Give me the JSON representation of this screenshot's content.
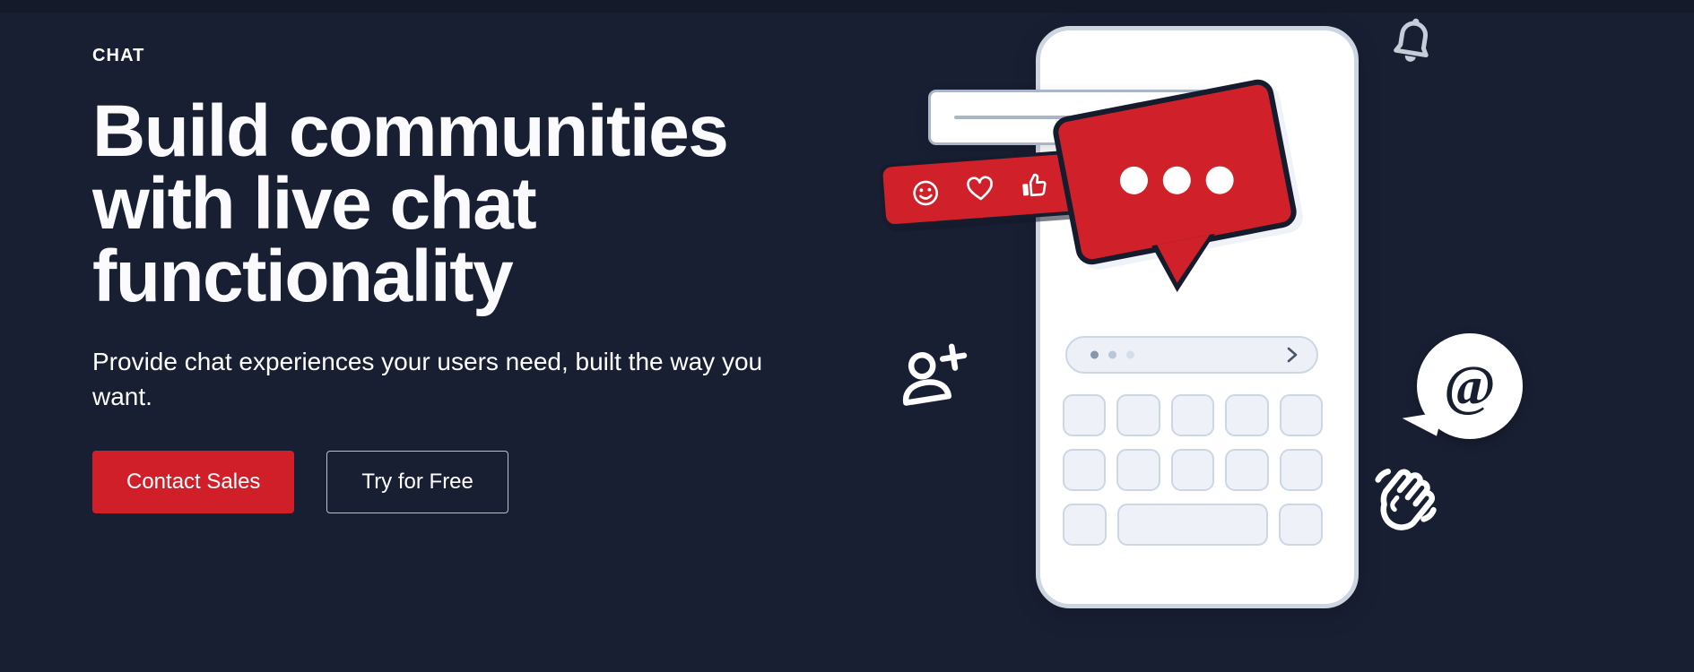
{
  "page": {
    "background_color": "#191f33",
    "accent_color": "#d01f29"
  },
  "hero": {
    "eyebrow": "CHAT",
    "headline": "Build communities with live chat functionality",
    "subhead": "Provide chat experiences your users need, built the way you want.",
    "buttons": [
      {
        "label": "Contact Sales",
        "style": "primary",
        "color": "#d01f29"
      },
      {
        "label": "Try for Free",
        "style": "secondary",
        "color": "#ffffff"
      }
    ]
  },
  "illustration": {
    "phone": {
      "name": "smartphone-mockup",
      "screen_color": "#ffffff",
      "bezel_color": "#ccd5e0"
    },
    "input_bar": {
      "name": "message-input-bar",
      "dots": 3,
      "send_icon": "chevron-right-icon"
    },
    "keyboard": {
      "name": "on-screen-keyboard",
      "rows": [
        {
          "keys": 5,
          "spacebar": false
        },
        {
          "keys": 5,
          "spacebar": false
        },
        {
          "keys": 2,
          "spacebar": true
        }
      ]
    },
    "message_bubble": {
      "name": "incoming-message-bubble",
      "color": "#ffffff",
      "border_color": "#aab6c7"
    },
    "reaction_bar": {
      "name": "reaction-bar",
      "color": "#d0212a",
      "reactions": [
        {
          "name": "smiley-icon",
          "label": "smile"
        },
        {
          "name": "heart-icon",
          "label": "love"
        },
        {
          "name": "thumbs-up-icon",
          "label": "like"
        }
      ]
    },
    "typing_bubble": {
      "name": "typing-indicator-bubble",
      "color": "#d0212a",
      "dots": 3
    },
    "floating_icons": [
      {
        "name": "bell-icon",
        "label": "notifications",
        "color": "#c6ccd8"
      },
      {
        "name": "add-person-icon",
        "label": "invite user",
        "color": "#ffffff"
      },
      {
        "name": "at-mention-bubble",
        "label": "@",
        "color": "#ffffff"
      },
      {
        "name": "clapping-hands-icon",
        "label": "applause",
        "color": "#ffffff"
      }
    ]
  }
}
